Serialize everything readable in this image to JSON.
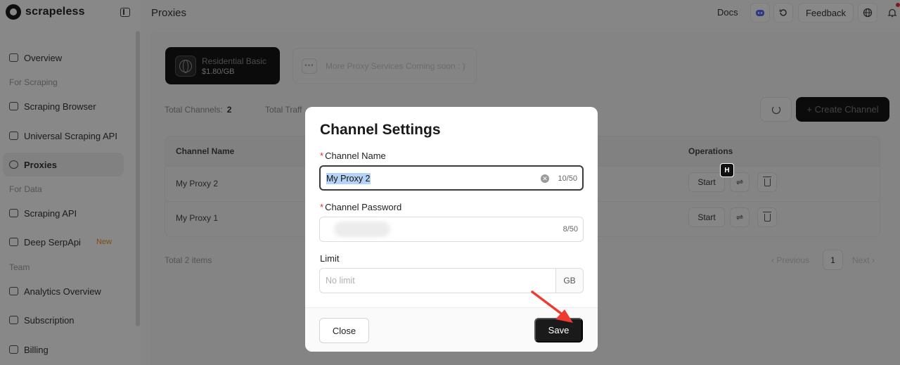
{
  "app": {
    "logo_text": "scrapeless"
  },
  "header": {
    "page_title": "Proxies",
    "docs_label": "Docs",
    "feedback_label": "Feedback"
  },
  "sidebar": {
    "items": [
      {
        "label": "Overview",
        "icon": "monitor-icon"
      },
      {
        "label": "Scraping Browser",
        "icon": "browser-icon"
      },
      {
        "label": "Universal Scraping API",
        "icon": "lock-icon"
      },
      {
        "label": "Proxies",
        "icon": "globe-icon"
      },
      {
        "label": "Scraping API",
        "icon": "api-icon"
      },
      {
        "label": "Deep SerpApi",
        "icon": "terminal-icon",
        "badge": "New"
      },
      {
        "label": "Analytics Overview",
        "icon": "chart-icon"
      },
      {
        "label": "Subscription",
        "icon": "subscription-icon"
      },
      {
        "label": "Billing",
        "icon": "billing-icon"
      }
    ],
    "sections": [
      "For Scraping",
      "For Data",
      "Team"
    ]
  },
  "main": {
    "service_card": {
      "name": "Residential Basic",
      "price": "$1.80/GB"
    },
    "coming_soon": "More Proxy Services Coming soon : )",
    "stats": {
      "total_channels_label": "Total Channels:",
      "total_channels_value": "2",
      "total_traffic_label": "Total Traff"
    },
    "create_channel_label": "+ Create Channel",
    "table": {
      "headers": [
        "Channel Name",
        "Operations"
      ],
      "rows": [
        {
          "name": "My Proxy 2",
          "start": "Start"
        },
        {
          "name": "My Proxy 1",
          "start": "Start"
        }
      ]
    },
    "total_items": "Total 2 items",
    "pagination": {
      "prev": "Previous",
      "page": "1",
      "next": "Next"
    }
  },
  "modal": {
    "title": "Channel Settings",
    "channel_name": {
      "label": "Channel Name",
      "value": "My Proxy 2",
      "counter": "10/50"
    },
    "channel_password": {
      "label": "Channel Password",
      "counter": "8/50"
    },
    "limit": {
      "label": "Limit",
      "placeholder": "No limit",
      "unit": "GB"
    },
    "close_label": "Close",
    "save_label": "Save"
  },
  "colors": {
    "accent": "#1a1a1a",
    "annotation_arrow": "#ee3b32",
    "new_badge": "#f08a24"
  }
}
